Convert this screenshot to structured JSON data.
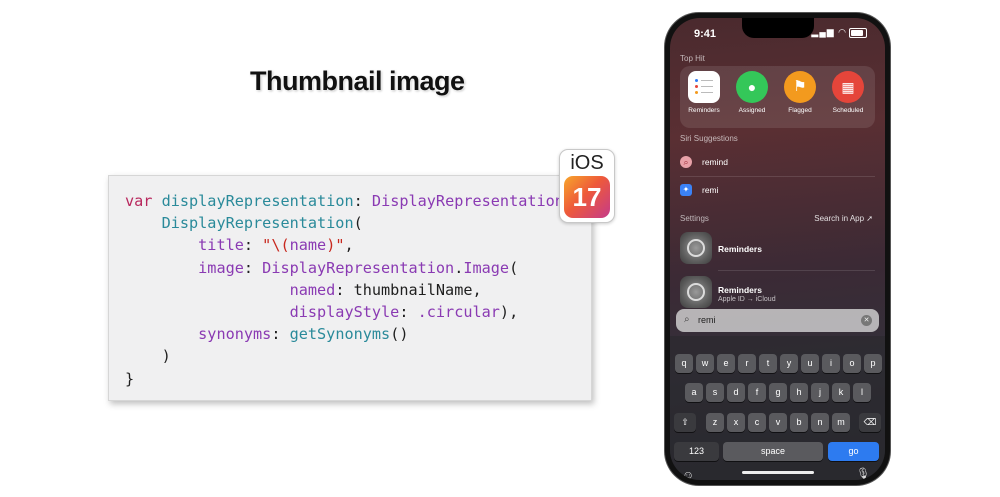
{
  "slide": {
    "title": "Thumbnail image"
  },
  "code": {
    "l1_kw": "var",
    "l1_prop": "displayRepresentation",
    "l1_sep": ": ",
    "l1_type": "DisplayRepresentation",
    "l2_type": "DisplayRepresentation",
    "l2_open": "(",
    "l3_param": "title",
    "l3_sep": ": ",
    "l3_q1": "\"\\(",
    "l3_name": "name",
    "l3_q2": ")\"",
    "l3_end": ",",
    "l4_param": "image",
    "l4_sep": ": ",
    "l4_type": "DisplayRepresentation",
    "l4_dot": ".",
    "l4_img": "Image",
    "l4_open": "(",
    "l5_param": "named",
    "l5_sep": ": ",
    "l5_val": "thumbnailName",
    "l5_end": ",",
    "l6_param": "displayStyle",
    "l6_sep": ": ",
    "l6_val": ".circular",
    "l6_end": "),",
    "l7_param": "synonyms",
    "l7_sep": ": ",
    "l7_fn": "getSynonyms",
    "l7_end": "()",
    "l8": ")",
    "l9": "}"
  },
  "badge": {
    "os": "iOS",
    "version": "17"
  },
  "phone": {
    "time": "9:41",
    "status": "▂▄▆ ◠",
    "top_hit_label": "Top Hit",
    "top_hits": [
      {
        "label": "Reminders",
        "color": "#ffffff",
        "icon": "reminders-app-icon"
      },
      {
        "label": "Assigned",
        "color": "#34c759",
        "icon": "person-icon",
        "glyph": "●"
      },
      {
        "label": "Flagged",
        "color": "#f39a1e",
        "icon": "flag-icon",
        "glyph": "⚑"
      },
      {
        "label": "Scheduled",
        "color": "#e5453a",
        "icon": "calendar-icon",
        "glyph": "▦"
      }
    ],
    "siri_label": "Siri Suggestions",
    "suggestions": [
      {
        "text": "remind",
        "icon": "search-icon",
        "color": "#e8a1a8",
        "glyph": "⌕"
      },
      {
        "text": "remi",
        "icon": "safari-icon",
        "color": "#3b82f6",
        "glyph": "✦"
      }
    ],
    "settings_label": "Settings",
    "search_in_app": "Search in App ➚",
    "settings_rows": [
      {
        "title": "Reminders",
        "subtitle": ""
      },
      {
        "title": "Reminders",
        "subtitle": "Apple ID → iCloud"
      }
    ],
    "search_query": "remi",
    "search_clear": "✕",
    "keys_row1": [
      "q",
      "w",
      "e",
      "r",
      "t",
      "y",
      "u",
      "i",
      "o",
      "p"
    ],
    "keys_row2": [
      "a",
      "s",
      "d",
      "f",
      "g",
      "h",
      "j",
      "k",
      "l"
    ],
    "keys_row3": [
      "z",
      "x",
      "c",
      "v",
      "b",
      "n",
      "m"
    ],
    "shift": "⇧",
    "delete": "⌫",
    "key_123": "123",
    "key_space": "space",
    "key_go": "go",
    "emoji": "☺",
    "mic": "🎙"
  }
}
